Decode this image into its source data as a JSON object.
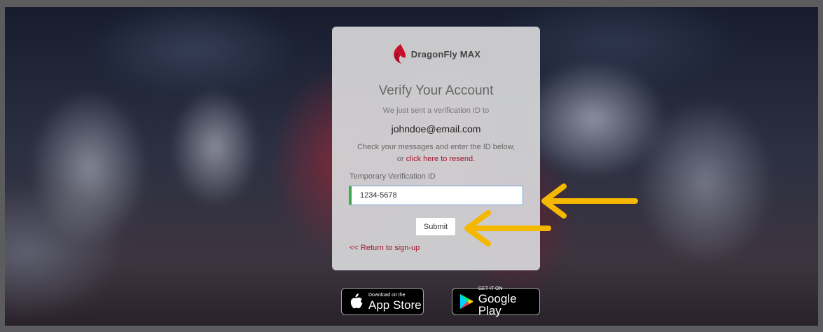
{
  "brand": {
    "name": "DragonFly MAX",
    "logo_icon": "dragonfly-flame-logo-icon",
    "logo_color": "#c8102e"
  },
  "verify": {
    "title": "Verify Your Account",
    "sent_text": "We just sent a verification ID to",
    "email": "johndoe@email.com",
    "instruction_line1": "Check your messages and enter the ID below,",
    "instruction_or": "or",
    "resend_link": "click here to resend.",
    "field_label": "Temporary Verification ID",
    "field_value": "1234-5678",
    "submit_label": "Submit",
    "return_link": "<< Return to sign-up"
  },
  "badges": {
    "apple": {
      "small": "Download on the",
      "big": "App Store",
      "icon": "apple-icon"
    },
    "google": {
      "small": "GET IT ON",
      "big": "Google Play",
      "icon": "google-play-icon"
    }
  },
  "annotations": {
    "arrow_color": "#f5b800",
    "arrow_icon": "arrow-left-icon"
  },
  "colors": {
    "accent": "#a3142b",
    "input_focus_bar": "#3cab4e",
    "input_border": "#7aa7d6"
  }
}
